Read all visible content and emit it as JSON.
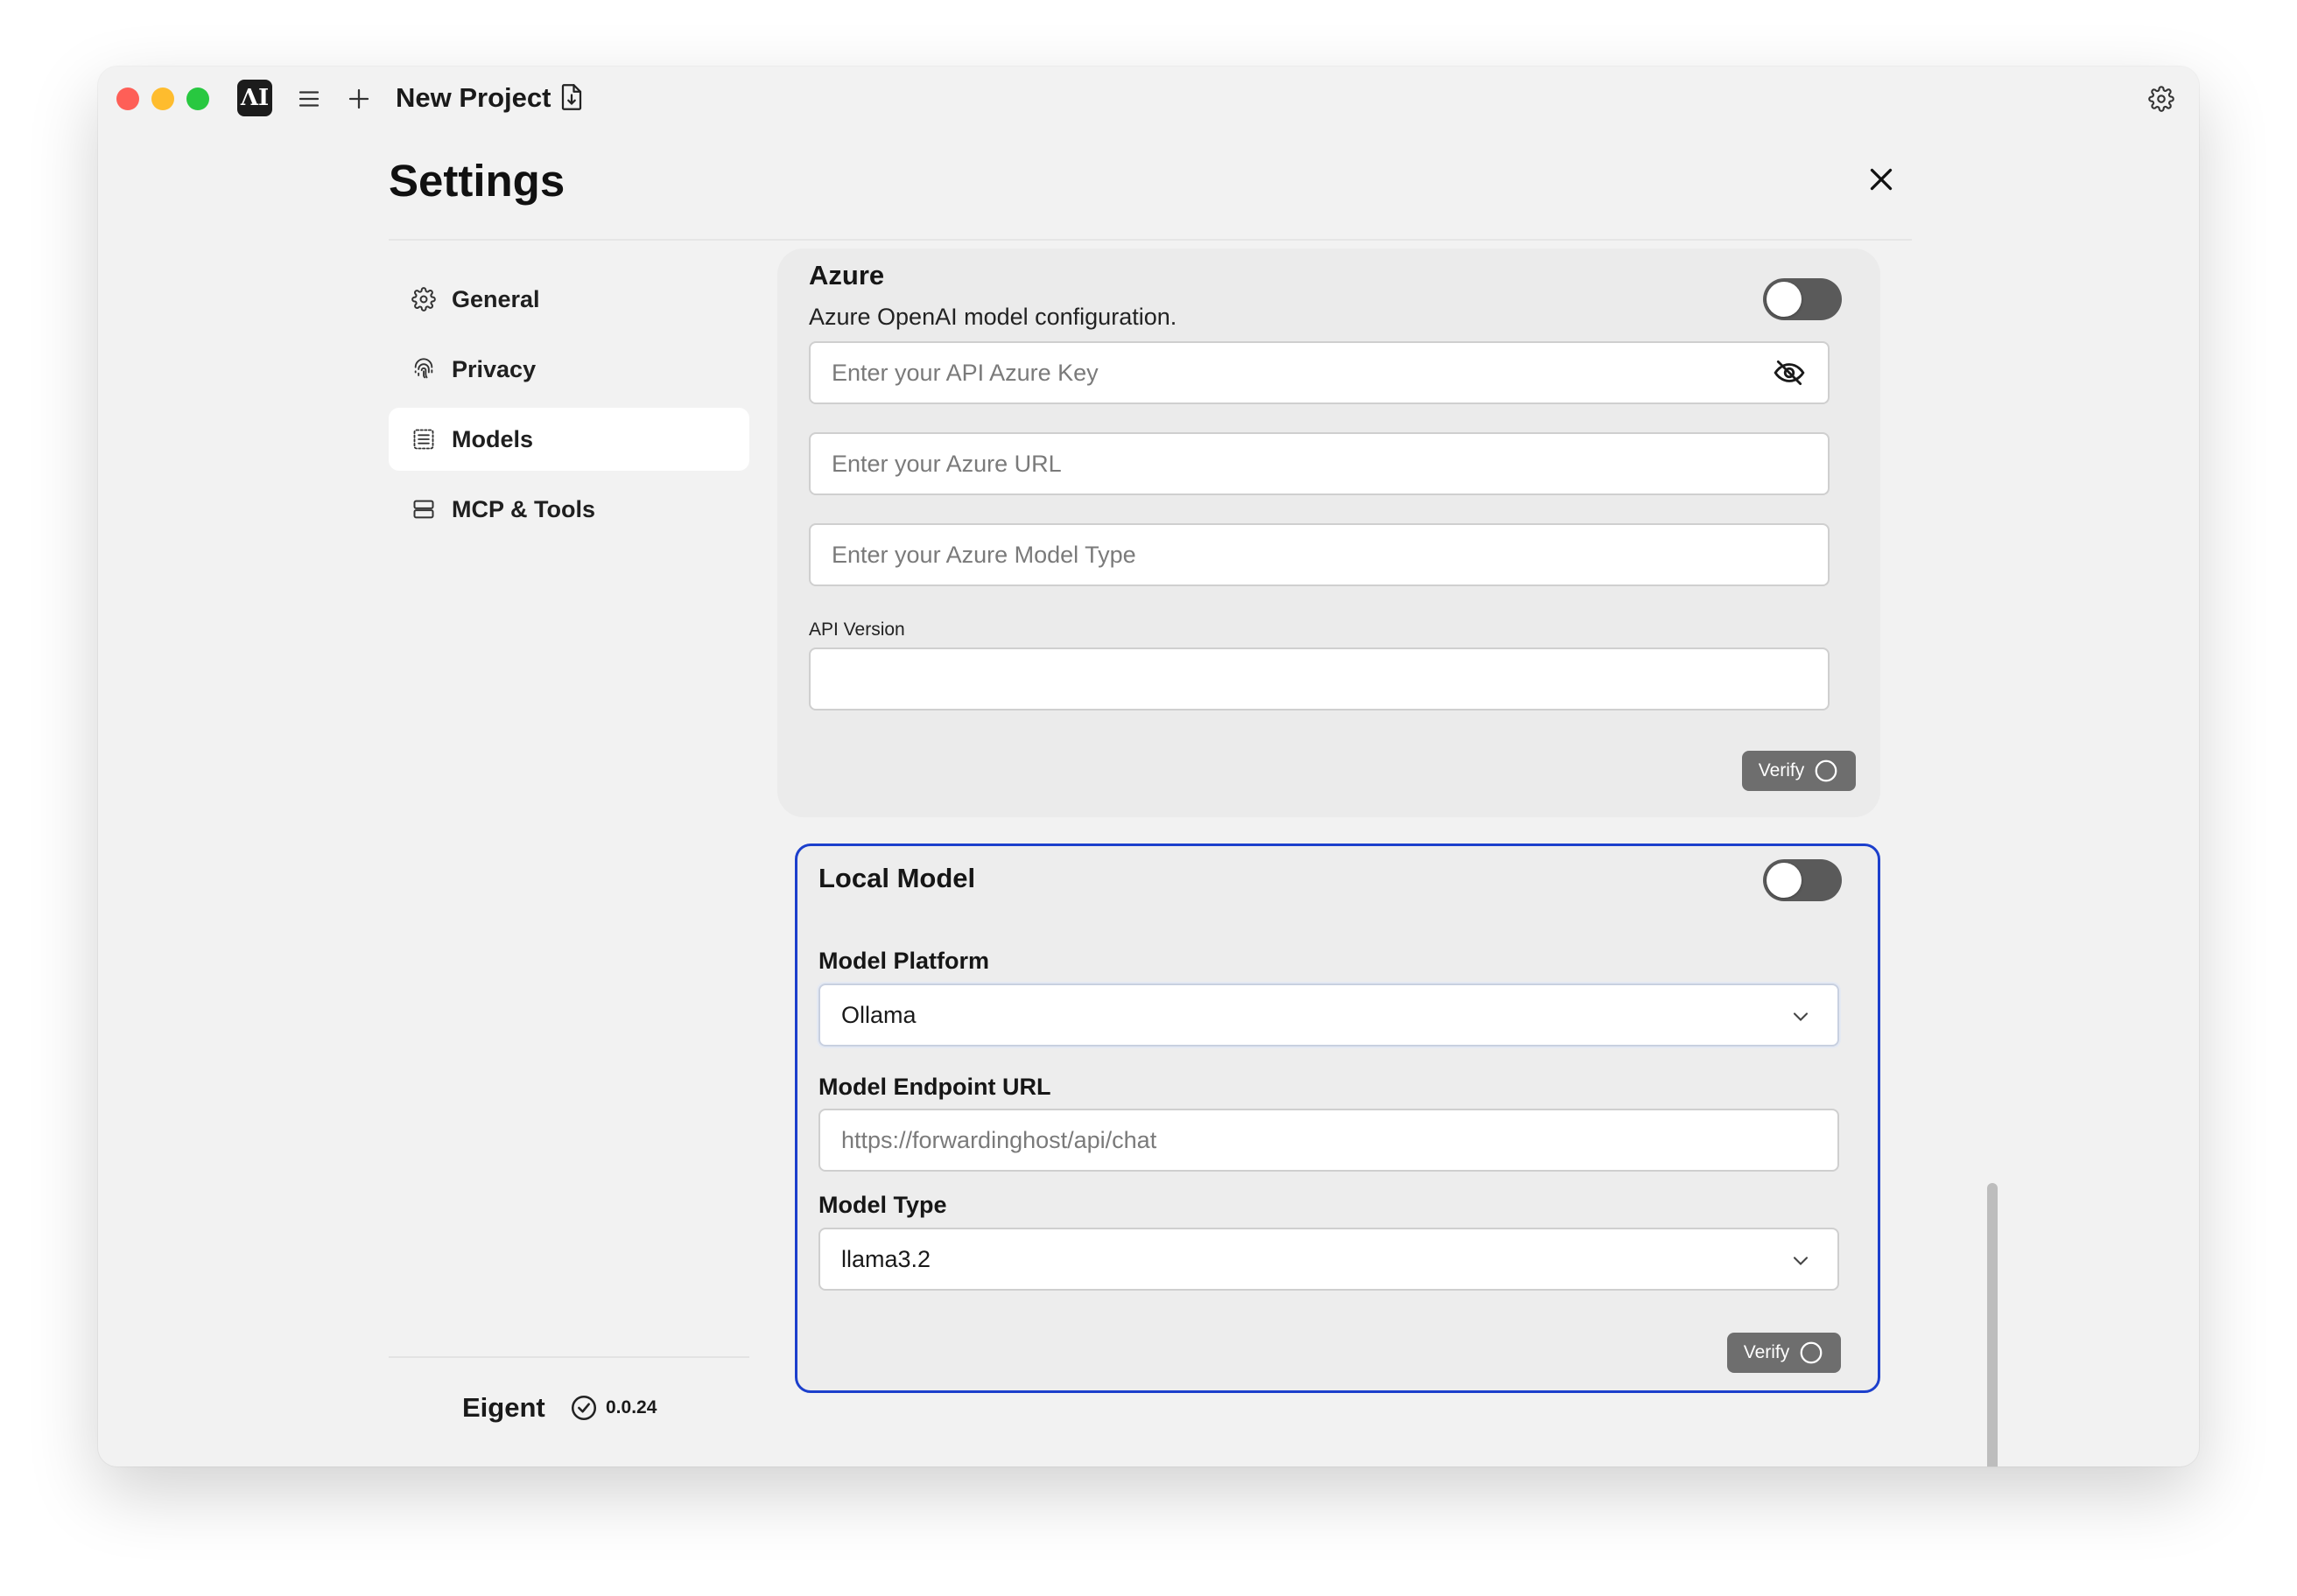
{
  "titlebar": {
    "logo_text": "ΛI",
    "project_title": "New Project"
  },
  "page": {
    "title": "Settings"
  },
  "sidebar": {
    "items": [
      {
        "label": "General",
        "icon": "gear-icon"
      },
      {
        "label": "Privacy",
        "icon": "fingerprint-icon"
      },
      {
        "label": "Models",
        "icon": "list-icon",
        "active": true
      },
      {
        "label": "MCP & Tools",
        "icon": "server-icon"
      }
    ],
    "brand": "Eigent",
    "version": "0.0.24"
  },
  "azure": {
    "title": "Azure",
    "description": "Azure OpenAI model configuration.",
    "enabled": false,
    "api_key_placeholder": "Enter your API Azure Key",
    "url_placeholder": "Enter your Azure URL",
    "model_type_placeholder": "Enter your Azure Model Type",
    "api_version_label": "API Version",
    "api_version_value": "",
    "verify_label": "Verify"
  },
  "local_model": {
    "title": "Local Model",
    "enabled": false,
    "platform_label": "Model Platform",
    "platform_value": "Ollama",
    "endpoint_label": "Model Endpoint URL",
    "endpoint_placeholder": "https://forwardinghost/api/chat",
    "model_type_label": "Model Type",
    "model_type_value": "llama3.2",
    "verify_label": "Verify"
  },
  "colors": {
    "window_bg": "#f2f2f2",
    "card_bg": "#ebebeb",
    "focus_border": "#1c3fcc",
    "toggle_off": "#5a5a5a",
    "verify_bg": "#6e6e6e"
  }
}
